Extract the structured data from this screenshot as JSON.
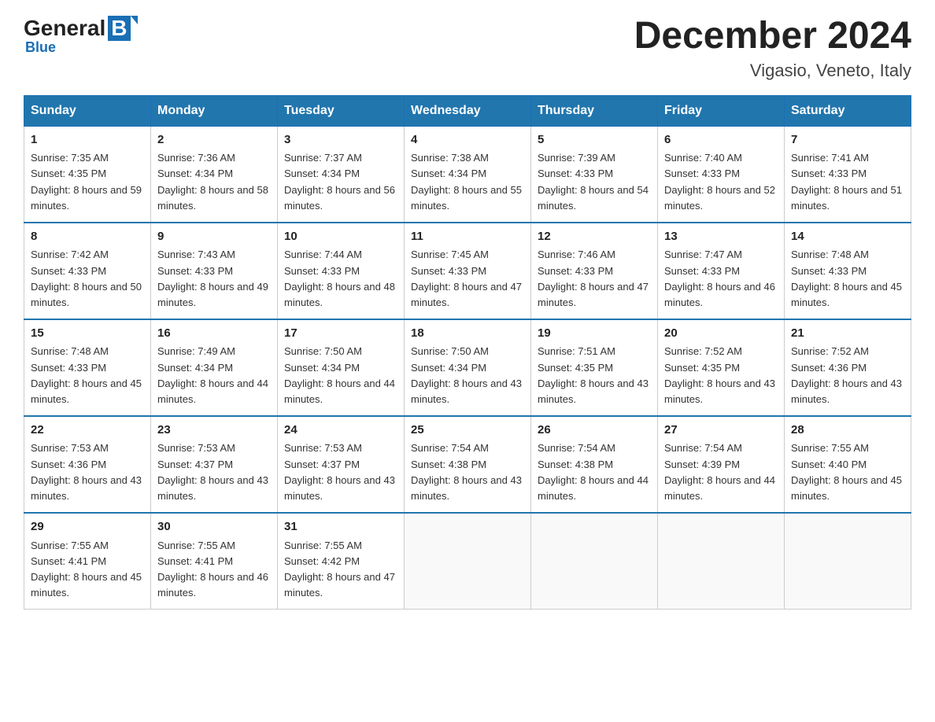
{
  "header": {
    "logo": {
      "general": "General",
      "blue": "Blue"
    },
    "title": "December 2024",
    "location": "Vigasio, Veneto, Italy"
  },
  "days_of_week": [
    "Sunday",
    "Monday",
    "Tuesday",
    "Wednesday",
    "Thursday",
    "Friday",
    "Saturday"
  ],
  "weeks": [
    [
      {
        "day": 1,
        "sunrise": "7:35 AM",
        "sunset": "4:35 PM",
        "daylight": "8 hours and 59 minutes."
      },
      {
        "day": 2,
        "sunrise": "7:36 AM",
        "sunset": "4:34 PM",
        "daylight": "8 hours and 58 minutes."
      },
      {
        "day": 3,
        "sunrise": "7:37 AM",
        "sunset": "4:34 PM",
        "daylight": "8 hours and 56 minutes."
      },
      {
        "day": 4,
        "sunrise": "7:38 AM",
        "sunset": "4:34 PM",
        "daylight": "8 hours and 55 minutes."
      },
      {
        "day": 5,
        "sunrise": "7:39 AM",
        "sunset": "4:33 PM",
        "daylight": "8 hours and 54 minutes."
      },
      {
        "day": 6,
        "sunrise": "7:40 AM",
        "sunset": "4:33 PM",
        "daylight": "8 hours and 52 minutes."
      },
      {
        "day": 7,
        "sunrise": "7:41 AM",
        "sunset": "4:33 PM",
        "daylight": "8 hours and 51 minutes."
      }
    ],
    [
      {
        "day": 8,
        "sunrise": "7:42 AM",
        "sunset": "4:33 PM",
        "daylight": "8 hours and 50 minutes."
      },
      {
        "day": 9,
        "sunrise": "7:43 AM",
        "sunset": "4:33 PM",
        "daylight": "8 hours and 49 minutes."
      },
      {
        "day": 10,
        "sunrise": "7:44 AM",
        "sunset": "4:33 PM",
        "daylight": "8 hours and 48 minutes."
      },
      {
        "day": 11,
        "sunrise": "7:45 AM",
        "sunset": "4:33 PM",
        "daylight": "8 hours and 47 minutes."
      },
      {
        "day": 12,
        "sunrise": "7:46 AM",
        "sunset": "4:33 PM",
        "daylight": "8 hours and 47 minutes."
      },
      {
        "day": 13,
        "sunrise": "7:47 AM",
        "sunset": "4:33 PM",
        "daylight": "8 hours and 46 minutes."
      },
      {
        "day": 14,
        "sunrise": "7:48 AM",
        "sunset": "4:33 PM",
        "daylight": "8 hours and 45 minutes."
      }
    ],
    [
      {
        "day": 15,
        "sunrise": "7:48 AM",
        "sunset": "4:33 PM",
        "daylight": "8 hours and 45 minutes."
      },
      {
        "day": 16,
        "sunrise": "7:49 AM",
        "sunset": "4:34 PM",
        "daylight": "8 hours and 44 minutes."
      },
      {
        "day": 17,
        "sunrise": "7:50 AM",
        "sunset": "4:34 PM",
        "daylight": "8 hours and 44 minutes."
      },
      {
        "day": 18,
        "sunrise": "7:50 AM",
        "sunset": "4:34 PM",
        "daylight": "8 hours and 43 minutes."
      },
      {
        "day": 19,
        "sunrise": "7:51 AM",
        "sunset": "4:35 PM",
        "daylight": "8 hours and 43 minutes."
      },
      {
        "day": 20,
        "sunrise": "7:52 AM",
        "sunset": "4:35 PM",
        "daylight": "8 hours and 43 minutes."
      },
      {
        "day": 21,
        "sunrise": "7:52 AM",
        "sunset": "4:36 PM",
        "daylight": "8 hours and 43 minutes."
      }
    ],
    [
      {
        "day": 22,
        "sunrise": "7:53 AM",
        "sunset": "4:36 PM",
        "daylight": "8 hours and 43 minutes."
      },
      {
        "day": 23,
        "sunrise": "7:53 AM",
        "sunset": "4:37 PM",
        "daylight": "8 hours and 43 minutes."
      },
      {
        "day": 24,
        "sunrise": "7:53 AM",
        "sunset": "4:37 PM",
        "daylight": "8 hours and 43 minutes."
      },
      {
        "day": 25,
        "sunrise": "7:54 AM",
        "sunset": "4:38 PM",
        "daylight": "8 hours and 43 minutes."
      },
      {
        "day": 26,
        "sunrise": "7:54 AM",
        "sunset": "4:38 PM",
        "daylight": "8 hours and 44 minutes."
      },
      {
        "day": 27,
        "sunrise": "7:54 AM",
        "sunset": "4:39 PM",
        "daylight": "8 hours and 44 minutes."
      },
      {
        "day": 28,
        "sunrise": "7:55 AM",
        "sunset": "4:40 PM",
        "daylight": "8 hours and 45 minutes."
      }
    ],
    [
      {
        "day": 29,
        "sunrise": "7:55 AM",
        "sunset": "4:41 PM",
        "daylight": "8 hours and 45 minutes."
      },
      {
        "day": 30,
        "sunrise": "7:55 AM",
        "sunset": "4:41 PM",
        "daylight": "8 hours and 46 minutes."
      },
      {
        "day": 31,
        "sunrise": "7:55 AM",
        "sunset": "4:42 PM",
        "daylight": "8 hours and 47 minutes."
      },
      null,
      null,
      null,
      null
    ]
  ]
}
